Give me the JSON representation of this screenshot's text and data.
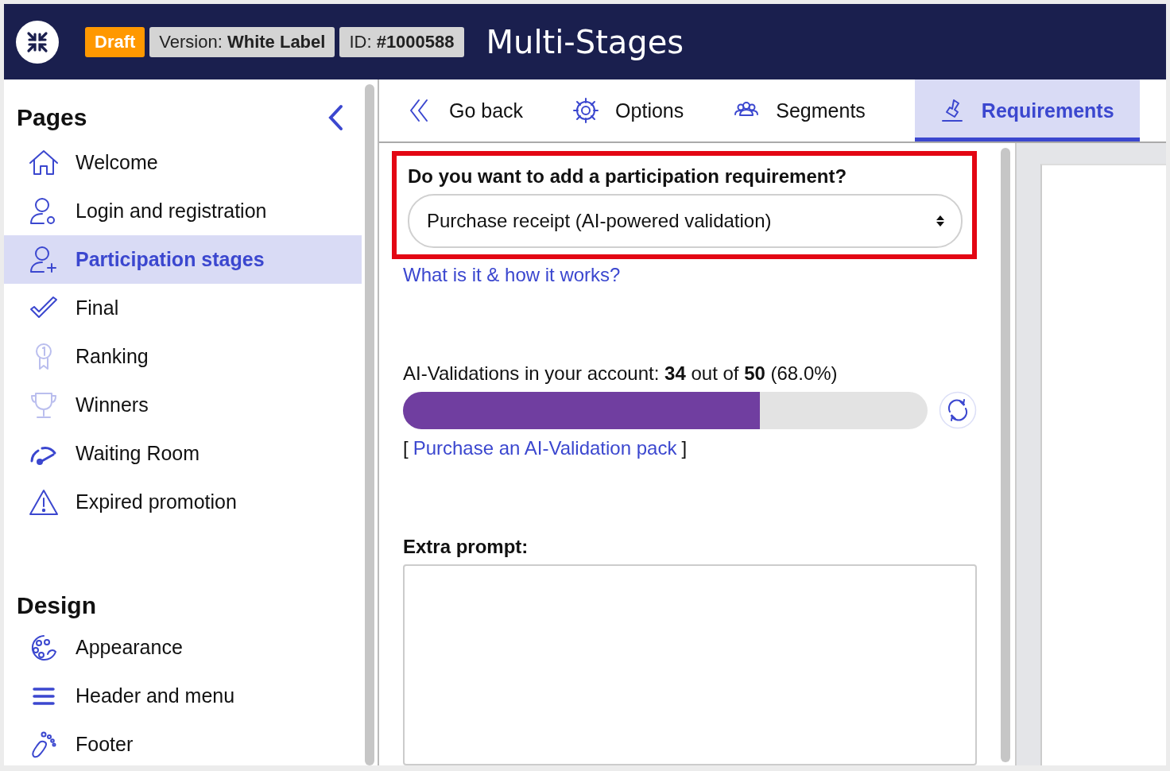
{
  "header": {
    "badges": [
      {
        "kind": "status",
        "text": "Draft"
      },
      {
        "kind": "info",
        "label": "Version:",
        "value": "White Label"
      },
      {
        "kind": "info",
        "label": "ID:",
        "value": "#1000588"
      }
    ],
    "title": "Multi-Stages"
  },
  "sidebar": {
    "sections": [
      {
        "title": "Pages",
        "items": [
          {
            "label": "Welcome",
            "selected": false,
            "dimmed": false
          },
          {
            "label": "Login and registration",
            "selected": false,
            "dimmed": false
          },
          {
            "label": "Participation stages",
            "selected": true,
            "dimmed": false
          },
          {
            "label": "Final",
            "selected": false,
            "dimmed": false
          },
          {
            "label": "Ranking",
            "selected": false,
            "dimmed": true
          },
          {
            "label": "Winners",
            "selected": false,
            "dimmed": true
          },
          {
            "label": "Waiting Room",
            "selected": false,
            "dimmed": false
          },
          {
            "label": "Expired promotion",
            "selected": false,
            "dimmed": false
          }
        ]
      },
      {
        "title": "Design",
        "items": [
          {
            "label": "Appearance",
            "selected": false,
            "dimmed": false
          },
          {
            "label": "Header and menu",
            "selected": false,
            "dimmed": false
          },
          {
            "label": "Footer",
            "selected": false,
            "dimmed": false
          }
        ]
      }
    ]
  },
  "tabs": [
    {
      "label": "Go back",
      "selected": false
    },
    {
      "label": "Options",
      "selected": false
    },
    {
      "label": "Segments",
      "selected": false
    },
    {
      "label": "Requirements",
      "selected": true
    }
  ],
  "requirement": {
    "highlighted": true,
    "question": "Do you want to add a participation requirement?",
    "value": "Purchase receipt (AI-powered validation)",
    "help_link": "What is it & how it works?"
  },
  "validations": {
    "text": "AI-Validations in your account: **34** out of **50** (68.0%)",
    "level": 0.68,
    "open_bracket": "[",
    "link": "Purchase an AI-Validation pack",
    "close_bracket": "]"
  },
  "extra_prompt": {
    "label": "Extra prompt:"
  }
}
